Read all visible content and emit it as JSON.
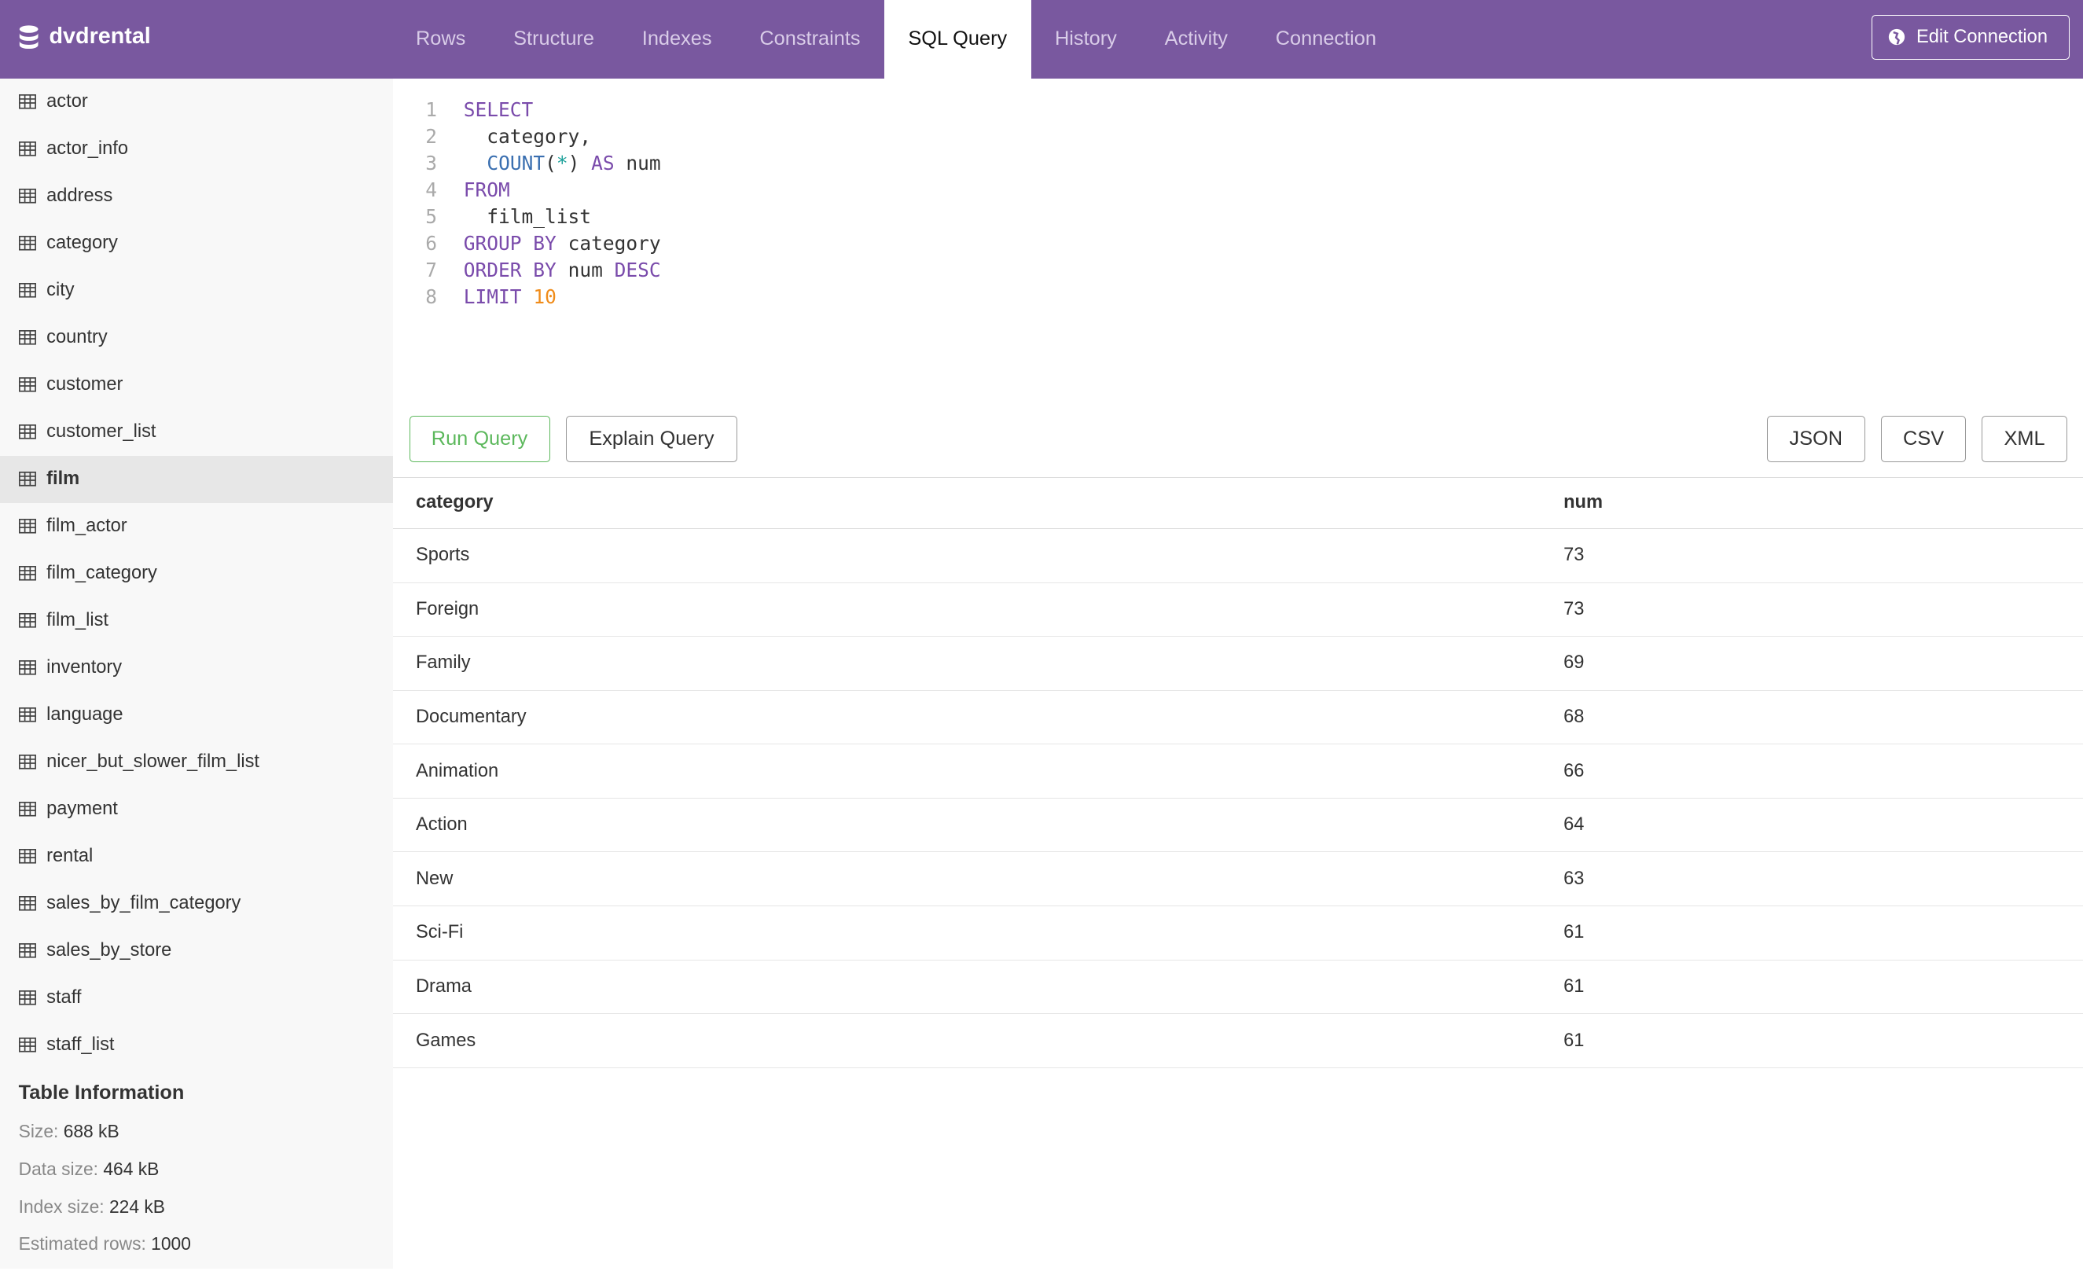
{
  "app": {
    "title": "dvdrental",
    "edit_connection": "Edit Connection",
    "brand_color": "#79589f"
  },
  "tabs": [
    {
      "label": "Rows"
    },
    {
      "label": "Structure"
    },
    {
      "label": "Indexes"
    },
    {
      "label": "Constraints"
    },
    {
      "label": "SQL Query",
      "active": true
    },
    {
      "label": "History"
    },
    {
      "label": "Activity"
    },
    {
      "label": "Connection"
    }
  ],
  "sidebar": {
    "items": [
      "actor",
      "actor_info",
      "address",
      "category",
      "city",
      "country",
      "customer",
      "customer_list",
      "film",
      "film_actor",
      "film_category",
      "film_list",
      "inventory",
      "language",
      "nicer_but_slower_film_list",
      "payment",
      "rental",
      "sales_by_film_category",
      "sales_by_store",
      "staff",
      "staff_list"
    ],
    "selected": "film"
  },
  "info": {
    "title": "Table Information",
    "size_label": "Size:",
    "size": "688 kB",
    "data_size_label": "Data size:",
    "data_size": "464 kB",
    "index_size_label": "Index size:",
    "index_size": "224 kB",
    "rows_label": "Estimated rows:",
    "rows": "1000"
  },
  "editor": {
    "lines": [
      [
        {
          "t": "SELECT",
          "c": "kw"
        }
      ],
      [
        {
          "t": "  category,",
          "c": "id"
        }
      ],
      [
        {
          "t": "  ",
          "c": "id"
        },
        {
          "t": "COUNT",
          "c": "fn"
        },
        {
          "t": "(",
          "c": "id"
        },
        {
          "t": "*",
          "c": "op"
        },
        {
          "t": ") ",
          "c": "id"
        },
        {
          "t": "AS",
          "c": "kw"
        },
        {
          "t": " num",
          "c": "id"
        }
      ],
      [
        {
          "t": "FROM",
          "c": "kw"
        }
      ],
      [
        {
          "t": "  film_list",
          "c": "id"
        }
      ],
      [
        {
          "t": "GROUP BY",
          "c": "kw"
        },
        {
          "t": " category",
          "c": "id"
        }
      ],
      [
        {
          "t": "ORDER BY",
          "c": "kw"
        },
        {
          "t": " num ",
          "c": "id"
        },
        {
          "t": "DESC",
          "c": "kw"
        }
      ],
      [
        {
          "t": "LIMIT",
          "c": "kw"
        },
        {
          "t": " ",
          "c": "id"
        },
        {
          "t": "10",
          "c": "num"
        }
      ]
    ]
  },
  "buttons": {
    "run": "Run Query",
    "explain": "Explain Query",
    "json": "JSON",
    "csv": "CSV",
    "xml": "XML"
  },
  "results": {
    "columns": [
      "category",
      "num"
    ],
    "rows": [
      [
        "Sports",
        "73"
      ],
      [
        "Foreign",
        "73"
      ],
      [
        "Family",
        "69"
      ],
      [
        "Documentary",
        "68"
      ],
      [
        "Animation",
        "66"
      ],
      [
        "Action",
        "64"
      ],
      [
        "New",
        "63"
      ],
      [
        "Sci-Fi",
        "61"
      ],
      [
        "Drama",
        "61"
      ],
      [
        "Games",
        "61"
      ]
    ]
  }
}
